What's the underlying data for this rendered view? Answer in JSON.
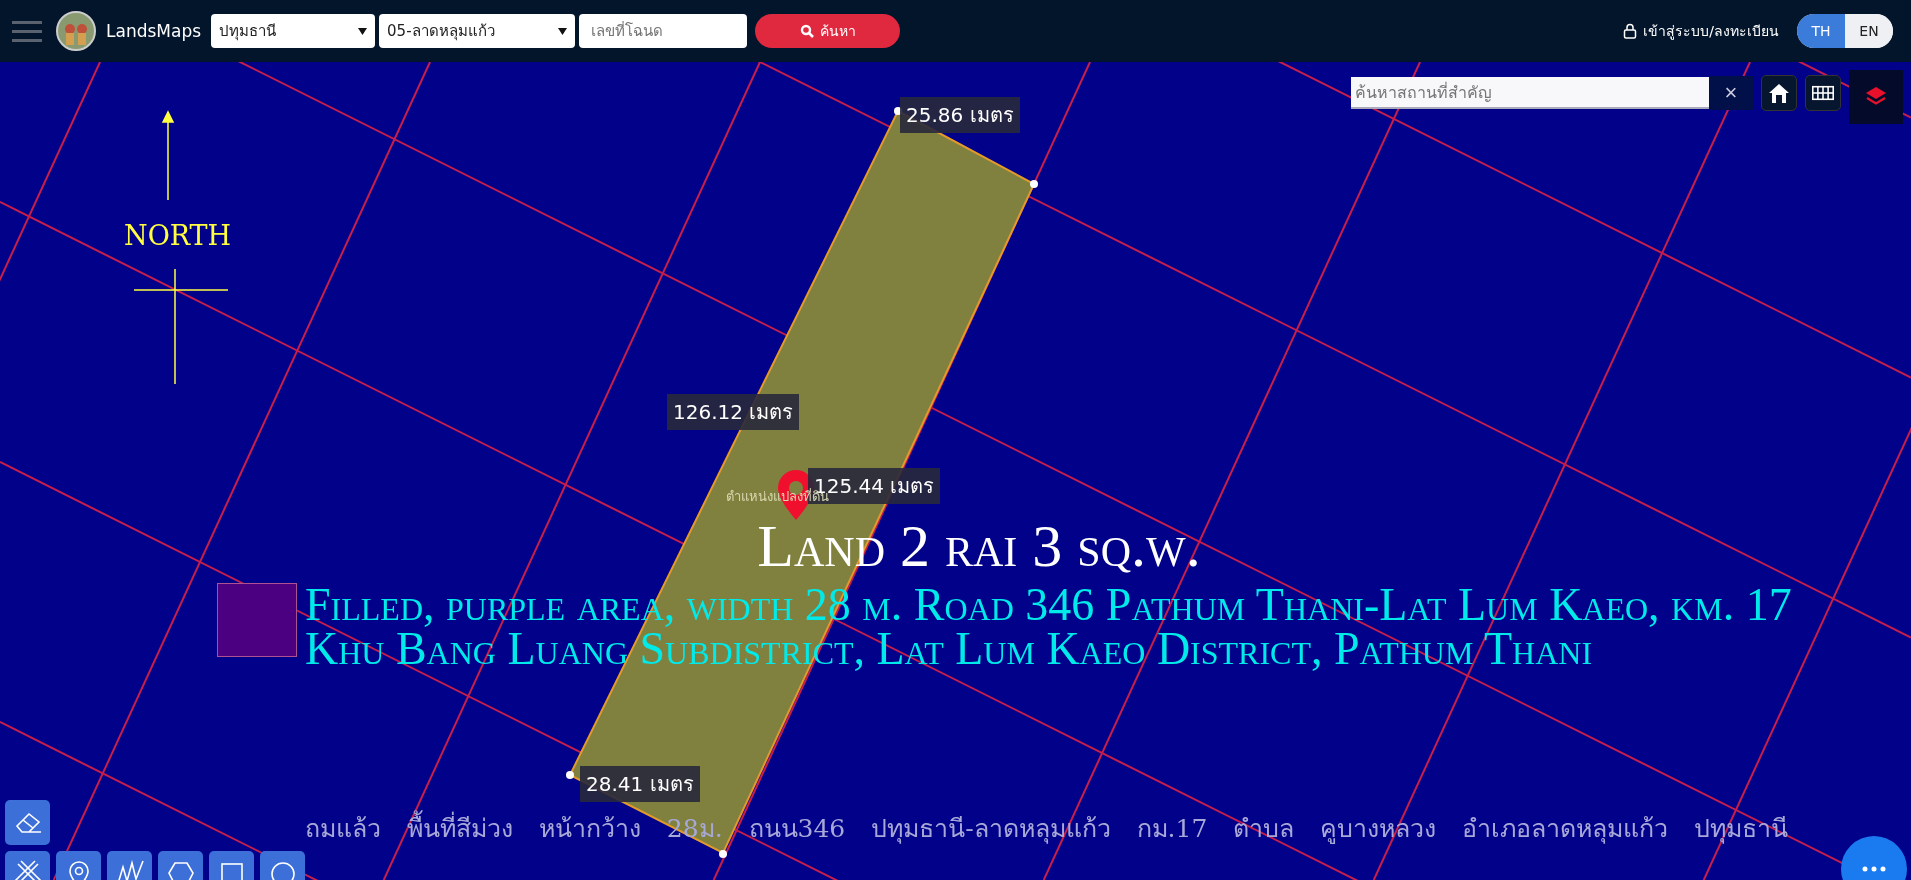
{
  "header": {
    "brand": "LandsMaps",
    "province_select": {
      "value": "ปทุมธานี"
    },
    "district_select": {
      "value": "05-ลาดหลุมแก้ว"
    },
    "deed_field": {
      "placeholder": "เลขที่โฉนด"
    },
    "search_button": "ค้นหา",
    "login_link": "เข้าสู่ระบบ/ลงทะเบียน",
    "languages": [
      {
        "label": "TH",
        "selected": true
      },
      {
        "label": "EN",
        "selected": false
      }
    ]
  },
  "place_search": {
    "placeholder": "ค้นหาสถานที่สำคัญ",
    "clear": "×"
  },
  "map": {
    "north_label": "NORTH",
    "measurements": [
      "25.86 เมตร",
      "126.12 เมตร",
      "125.44 เมตร",
      "28.41 เมตร"
    ],
    "pin_label": "ตำแหน่งแปลงที่ดิน",
    "title": "Land 2 rai 3 sq.w.",
    "legend_lines": [
      "Filled, purple area, width 28 m. Road 346 Pathum Thani-Lat Lum Kaeo, km. 17",
      "Khu Bang Luang Subdistrict, Lat Lum Kaeo District, Pathum Thani"
    ],
    "thai_caption": "ถมแล้ว พื้นที่สีม่วง หน้ากว้าง 28ม. ถนน346 ปทุมธานี-ลาดหลุมแก้ว กม.17 ตำบล คูบางหลวง อำเภอลาดหลุมแก้ว ปทุมธานี"
  },
  "tools": [
    {
      "kind": "eraser"
    },
    {
      "kind": "measure"
    },
    {
      "kind": "pin"
    },
    {
      "kind": "line"
    },
    {
      "kind": "polygon"
    },
    {
      "kind": "rectangle"
    },
    {
      "kind": "circle"
    }
  ]
}
